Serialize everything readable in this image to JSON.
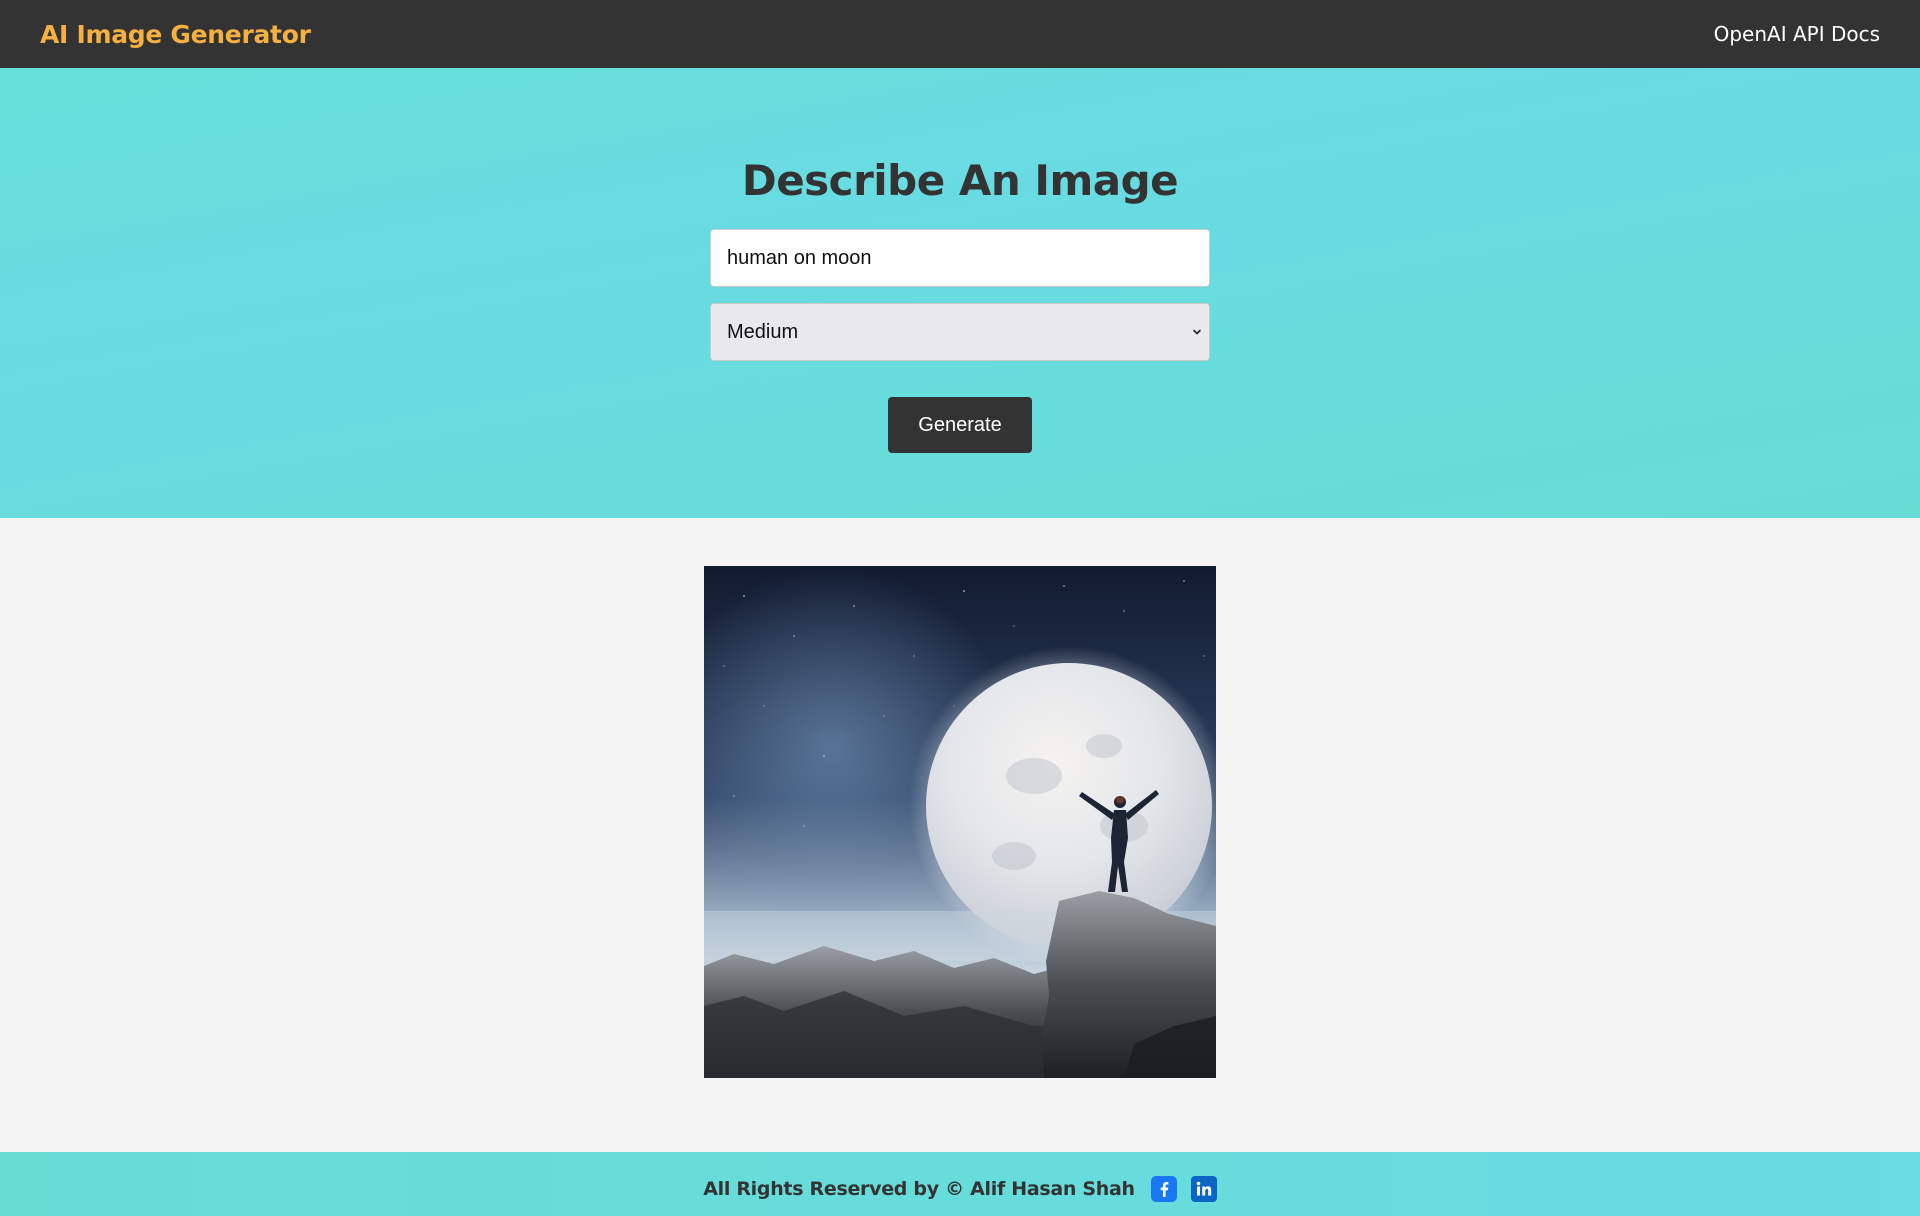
{
  "navbar": {
    "brand": "AI Image Generator",
    "docs_link": "OpenAI API Docs"
  },
  "hero": {
    "title": "Describe An Image",
    "prompt_value": "human on moon",
    "size_selected": "Medium",
    "generate_label": "Generate"
  },
  "result": {
    "image_alt": "human on moon"
  },
  "footer": {
    "text": "All Rights Reserved by © Alif Hasan Shah",
    "facebook_icon": "facebook-icon",
    "linkedin_icon": "linkedin-icon"
  },
  "colors": {
    "navbar_bg": "#333333",
    "brand": "#f5b041",
    "hero_gradient_start": "#66dfd9",
    "hero_gradient_end": "#68dbe3",
    "button_bg": "#333333",
    "page_bg": "#f4f4f4"
  }
}
